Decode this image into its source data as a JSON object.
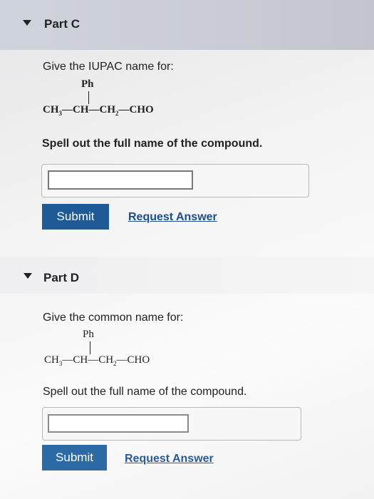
{
  "part_c": {
    "title": "Part C",
    "prompt": "Give the IUPAC name for:",
    "substituent": "Ph",
    "formula": {
      "ch3": "CH",
      "ch3_sub": "3",
      "dash1": "—",
      "ch": "CH",
      "dash2": "—",
      "ch2": "CH",
      "ch2_sub": "2",
      "dash3": "—",
      "cho": "CHO"
    },
    "instruction": "Spell out the full name of the compound.",
    "answer_value": "",
    "submit_label": "Submit",
    "request_label": "Request Answer"
  },
  "part_d": {
    "title": "Part D",
    "prompt": "Give the common name for:",
    "substituent": "Ph",
    "formula": {
      "ch3": "CH",
      "ch3_sub": "3",
      "dash1": "—",
      "ch": "CH",
      "dash2": "—",
      "ch2": "CH",
      "ch2_sub": "2",
      "dash3": "—",
      "cho": "CHO"
    },
    "instruction": "Spell out the full name of the compound.",
    "answer_value": "",
    "submit_label": "Submit",
    "request_label": "Request Answer"
  },
  "colors": {
    "submit_bg": "#1e5a96",
    "link": "#1d4d8a"
  }
}
